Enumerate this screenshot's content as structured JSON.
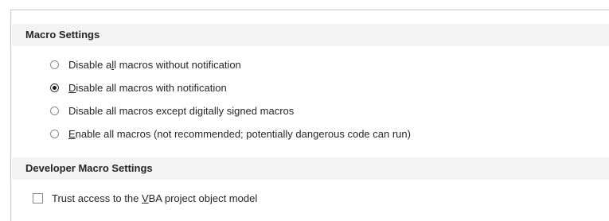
{
  "macro_settings": {
    "title": "Macro Settings",
    "options": [
      {
        "pre": "Disable a",
        "mnemonic": "l",
        "post": "l macros without notification",
        "checked": false
      },
      {
        "pre": "",
        "mnemonic": "D",
        "post": "isable all macros with notification",
        "checked": true
      },
      {
        "pre": "Disable all macros except di",
        "mnemonic": "g",
        "post": "itally signed macros",
        "checked": false
      },
      {
        "pre": "",
        "mnemonic": "E",
        "post": "nable all macros (not recommended; potentially dangerous code can run)",
        "checked": false
      }
    ]
  },
  "developer_macro_settings": {
    "title": "Developer Macro Settings",
    "trust_vba": {
      "pre": "Trust access to the ",
      "mnemonic": "V",
      "post": "BA project object model",
      "checked": false
    }
  }
}
